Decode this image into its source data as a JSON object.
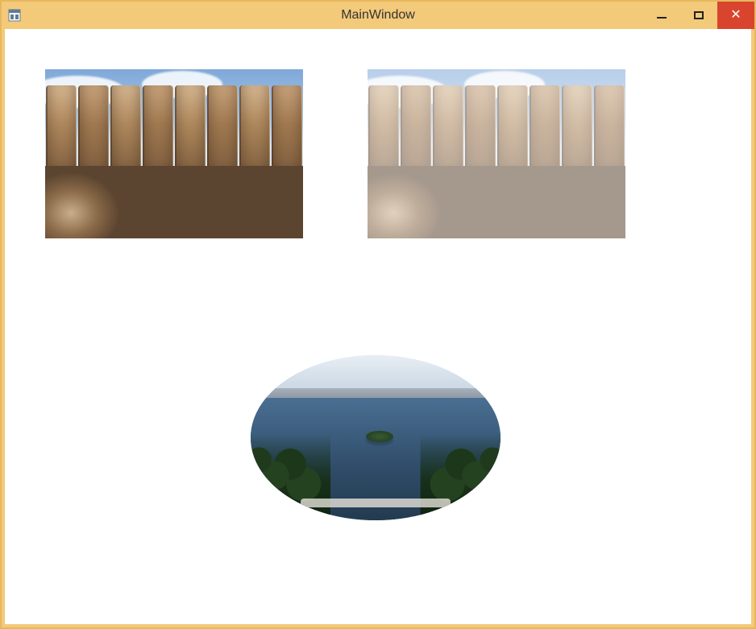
{
  "window": {
    "title": "MainWindow"
  },
  "controls": {
    "minimize_name": "minimize-button",
    "maximize_name": "maximize-button",
    "close_name": "close-button"
  },
  "images": {
    "left_description": "rock-cliffs-image",
    "right_description": "rock-cliffs-image-faded",
    "right_opacity": "0.55",
    "ellipse_description": "lake-island-ellipse-image"
  }
}
